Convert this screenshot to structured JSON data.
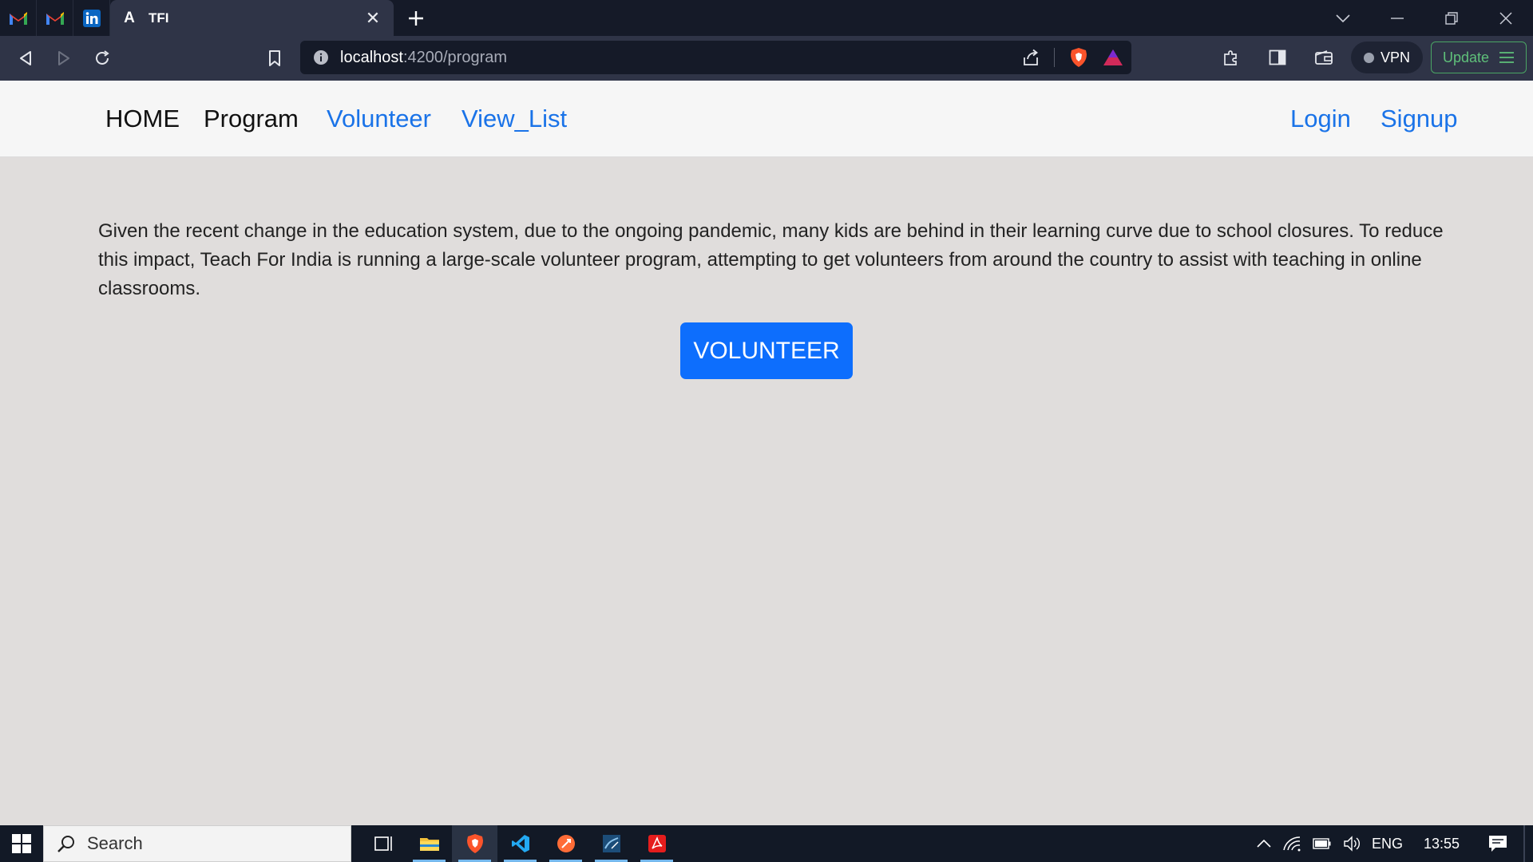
{
  "browser": {
    "tab_title": "TFI",
    "tab_favicon_letter": "A",
    "pinned_tabs": [
      "gmail-icon",
      "gmail-icon",
      "linkedin-icon"
    ],
    "address": {
      "host": "localhost",
      "path": ":4200/program"
    },
    "vpn_label": "VPN",
    "update_label": "Update"
  },
  "nav": {
    "home": "HOME",
    "program": "Program",
    "volunteer": "Volunteer",
    "view_list": "View_List",
    "login": "Login",
    "signup": "Signup"
  },
  "main": {
    "description": "Given the recent change in the education system, due to the ongoing pandemic, many kids are behind in their learning curve due to school closures. To reduce this impact, Teach For India is running a large-scale volunteer program, attempting to get volunteers from around the country to assist with teaching in online classrooms.",
    "volunteer_button": "VOLUNTEER"
  },
  "taskbar": {
    "search_placeholder": "Search",
    "language": "ENG",
    "time": "13:55"
  },
  "colors": {
    "page_bg": "#e0dddc",
    "navbar_bg": "#f6f6f6",
    "link_blue": "#1a73e8",
    "button_blue": "#0d6efd"
  }
}
